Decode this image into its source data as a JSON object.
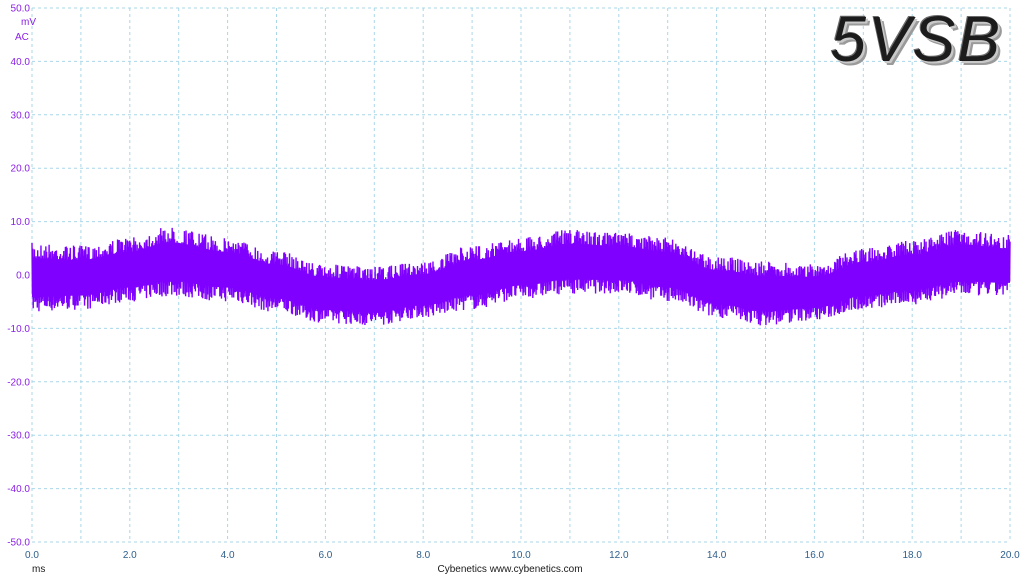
{
  "brand_label": "5VSB",
  "credit": "Cybenetics   www.cybenetics.com",
  "colors": {
    "signal": "#7f00ff",
    "grid": "#a9d7ea",
    "y_text": "#8a1fe6",
    "x_text": "#2d5f8c"
  },
  "chart_data": {
    "type": "line",
    "title": "5VSB",
    "xlabel": "ms",
    "ylabel": "mV",
    "ylabel2": "AC",
    "xlim": [
      0,
      20
    ],
    "ylim": [
      -50,
      50
    ],
    "x_ticks": [
      "0.0",
      "2.0",
      "4.0",
      "6.0",
      "8.0",
      "10.0",
      "12.0",
      "14.0",
      "16.0",
      "18.0",
      "20.0"
    ],
    "y_ticks": [
      "50.0",
      "40.0",
      "30.0",
      "20.0",
      "10.0",
      "0.0",
      "-10.0",
      "-20.0",
      "-30.0",
      "-40.0",
      "-50.0"
    ],
    "grid": true,
    "series": [
      {
        "name": "",
        "x": [
          0.0,
          1.0,
          2.0,
          2.8,
          4.0,
          5.0,
          6.0,
          7.0,
          8.0,
          9.0,
          10.0,
          11.0,
          12.0,
          13.0,
          14.0,
          15.0,
          16.0,
          17.0,
          18.0,
          19.0,
          20.0
        ],
        "upper": [
          6.0,
          5.5,
          7.0,
          9.0,
          7.0,
          4.5,
          2.0,
          1.5,
          2.5,
          5.5,
          7.0,
          8.5,
          8.0,
          7.0,
          3.5,
          2.5,
          2.0,
          5.0,
          6.5,
          8.5,
          7.5
        ],
        "lower": [
          -7.0,
          -6.5,
          -5.0,
          -4.0,
          -5.0,
          -7.0,
          -9.0,
          -9.5,
          -8.0,
          -6.5,
          -4.5,
          -3.5,
          -3.5,
          -5.0,
          -8.0,
          -9.5,
          -8.5,
          -6.5,
          -5.5,
          -4.0,
          -4.0
        ]
      }
    ]
  }
}
